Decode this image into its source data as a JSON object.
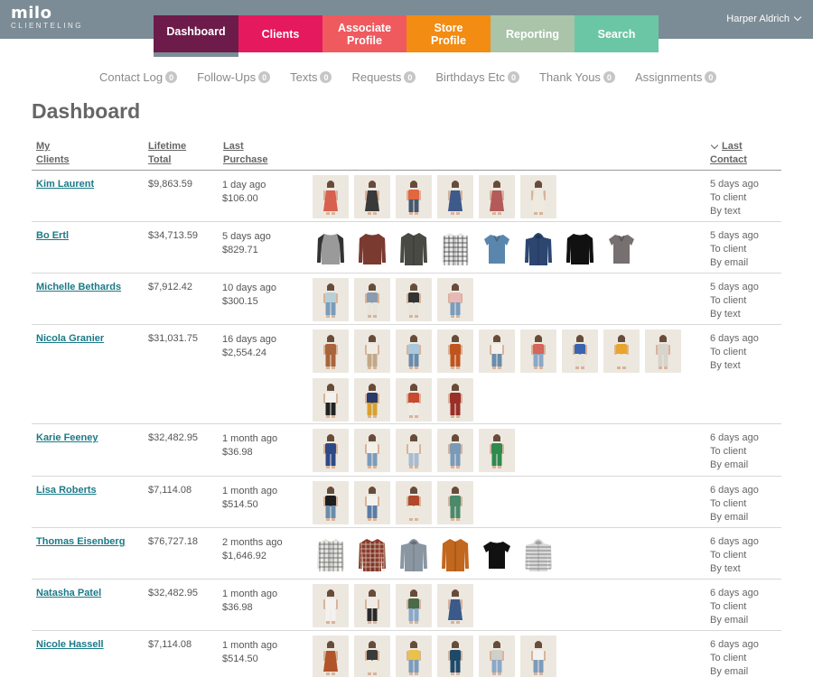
{
  "app": {
    "logo_main": "milo",
    "logo_sub": "CLIENTELING"
  },
  "user": {
    "name": "Harper Aldrich"
  },
  "nav": {
    "tabs": [
      {
        "label": "Dashboard",
        "color": "#6d1b4a",
        "active": true
      },
      {
        "label": "Clients",
        "color": "#e5195e",
        "active": false
      },
      {
        "label": "Associate Profile",
        "color": "#ef5a5f",
        "active": false
      },
      {
        "label": "Store Profile",
        "color": "#f28c13",
        "active": false
      },
      {
        "label": "Reporting",
        "color": "#a9c4a9",
        "active": false
      },
      {
        "label": "Search",
        "color": "#6bc6a6",
        "active": false
      }
    ]
  },
  "subnav": [
    {
      "label": "Contact Log",
      "count": "0"
    },
    {
      "label": "Follow-Ups",
      "count": "0"
    },
    {
      "label": "Texts",
      "count": "0"
    },
    {
      "label": "Requests",
      "count": "0"
    },
    {
      "label": "Birthdays Etc",
      "count": "0"
    },
    {
      "label": "Thank Yous",
      "count": "0"
    },
    {
      "label": "Assignments",
      "count": "0"
    }
  ],
  "page_title": "Dashboard",
  "table": {
    "headers": {
      "clients_l1": "My",
      "clients_l2": "Clients",
      "total_l1": "Lifetime",
      "total_l2": "Total",
      "purchase_l1": "Last",
      "purchase_l2": "Purchase",
      "contact_l1": "Last",
      "contact_l2": "Contact"
    },
    "rows": [
      {
        "name": "Kim Laurent",
        "total": "$9,863.59",
        "purchase_when": "1 day ago",
        "purchase_amount": "$106.00",
        "contact_when": "5 days ago",
        "contact_who": "To client",
        "contact_how": "By text",
        "items": [
          {
            "type": "model",
            "top": "#d8604e",
            "bottom": "#d8604e",
            "dress": true
          },
          {
            "type": "model",
            "top": "#3a3a3a",
            "bottom": "#3a3a3a",
            "dress": true
          },
          {
            "type": "model",
            "top": "#e0673e",
            "bottom": "#46586e",
            "dress": false
          },
          {
            "type": "model",
            "top": "#3e5a8a",
            "bottom": "#3e5a8a",
            "dress": true
          },
          {
            "type": "model",
            "top": "#b45a5a",
            "bottom": "#b45a5a",
            "dress": true
          },
          {
            "type": "model",
            "top": "#eeeae0",
            "bottom": "#eeeae0",
            "dress": true
          }
        ]
      },
      {
        "name": "Bo Ertl",
        "total": "$34,713.59",
        "purchase_when": "5 days ago",
        "purchase_amount": "$829.71",
        "contact_when": "5 days ago",
        "contact_who": "To client",
        "contact_how": "By email",
        "items": [
          {
            "type": "sweater",
            "color": "#9a9a9a",
            "sleeve": "#333333"
          },
          {
            "type": "sweater",
            "color": "#7a3a30",
            "sleeve": "#7a3a30"
          },
          {
            "type": "shirt",
            "color": "#4a4a44",
            "pattern": "none"
          },
          {
            "type": "shirt",
            "color": "#e8e8e8",
            "pattern": "plaid",
            "pattern_color": "#333333"
          },
          {
            "type": "polo",
            "color": "#5a86ad"
          },
          {
            "type": "hoodie",
            "color": "#2c4670"
          },
          {
            "type": "sweater",
            "color": "#111111",
            "sleeve": "#111111"
          },
          {
            "type": "polo",
            "color": "#777070"
          }
        ]
      },
      {
        "name": "Michelle Bethards",
        "total": "$7,912.42",
        "purchase_when": "10 days ago",
        "purchase_amount": "$300.15",
        "contact_when": "5 days ago",
        "contact_who": "To client",
        "contact_how": "By text",
        "items": [
          {
            "type": "model",
            "top": "#b8cfd8",
            "bottom": "#7a9cbc",
            "dress": false
          },
          {
            "type": "model",
            "top": "#8a9bb0",
            "bottom": "#e8e4da",
            "dress": false
          },
          {
            "type": "model",
            "top": "#333333",
            "bottom": "#e8e4da",
            "dress": false
          },
          {
            "type": "model",
            "top": "#e8b8b8",
            "bottom": "#7a9cbc",
            "dress": false
          }
        ]
      },
      {
        "name": "Nicola Granier",
        "total": "$31,031.75",
        "purchase_when": "16 days ago",
        "purchase_amount": "$2,554.24",
        "contact_when": "6 days ago",
        "contact_who": "To client",
        "contact_how": "By text",
        "items": [
          {
            "type": "model",
            "top": "#a8643a",
            "bottom": "#a8643a",
            "dress": false
          },
          {
            "type": "model",
            "top": "#f0ece4",
            "bottom": "#c2a888",
            "dress": false
          },
          {
            "type": "model",
            "top": "#aac8dc",
            "bottom": "#6a8cac",
            "dress": false
          },
          {
            "type": "model",
            "top": "#c0541e",
            "bottom": "#c0541e",
            "dress": false
          },
          {
            "type": "model",
            "top": "#f4f0ea",
            "bottom": "#6a8cac",
            "dress": false
          },
          {
            "type": "model",
            "top": "#d4665a",
            "bottom": "#8aa8c8",
            "dress": false
          },
          {
            "type": "model",
            "top": "#3a64b0",
            "bottom": "#e8e4da",
            "dress": false
          },
          {
            "type": "model",
            "top": "#e8a42c",
            "bottom": "#ece8dc",
            "dress": false
          },
          {
            "type": "model",
            "top": "#d8d4cc",
            "bottom": "#d8d4cc",
            "dress": false
          },
          {
            "type": "model",
            "top": "#f4f2ee",
            "bottom": "#222222",
            "dress": false
          },
          {
            "type": "model",
            "top": "#2a3a6a",
            "bottom": "#d8a030",
            "dress": false
          },
          {
            "type": "model",
            "top": "#c84a30",
            "bottom": "#f0ece4",
            "dress": false
          },
          {
            "type": "model",
            "top": "#9a2e28",
            "bottom": "#9a2e28",
            "dress": false
          }
        ]
      },
      {
        "name": "Karie Feeney",
        "total": "$32,482.95",
        "purchase_when": "1 month ago",
        "purchase_amount": "$36.98",
        "contact_when": "6 days ago",
        "contact_who": "To client",
        "contact_how": "By email",
        "items": [
          {
            "type": "model",
            "top": "#2e4a86",
            "bottom": "#2e4a86",
            "dress": false
          },
          {
            "type": "model",
            "top": "#f4f0ea",
            "bottom": "#7a9cbc",
            "dress": false
          },
          {
            "type": "model",
            "top": "#f0ece4",
            "bottom": "#a8bcd0",
            "dress": false
          },
          {
            "type": "model",
            "top": "#7a9ab8",
            "bottom": "#7a9ab8",
            "dress": false
          },
          {
            "type": "model",
            "top": "#2e8a4e",
            "bottom": "#2e8a4e",
            "dress": false
          }
        ]
      },
      {
        "name": "Lisa Roberts",
        "total": "$7,114.08",
        "purchase_when": "1 month ago",
        "purchase_amount": "$514.50",
        "contact_when": "6 days ago",
        "contact_who": "To client",
        "contact_how": "By email",
        "items": [
          {
            "type": "model",
            "top": "#1e1e1e",
            "bottom": "#6a8cac",
            "dress": false
          },
          {
            "type": "model",
            "top": "#f4f2ee",
            "bottom": "#5a7ca8",
            "dress": false
          },
          {
            "type": "model",
            "top": "#b0482c",
            "bottom": "#ece8dc",
            "dress": false
          },
          {
            "type": "model",
            "top": "#4a8a6a",
            "bottom": "#4a8a6a",
            "dress": false
          }
        ]
      },
      {
        "name": "Thomas Eisenberg",
        "total": "$76,727.18",
        "purchase_when": "2 months ago",
        "purchase_amount": "$1,646.92",
        "contact_when": "6 days ago",
        "contact_who": "To client",
        "contact_how": "By text",
        "items": [
          {
            "type": "shirt",
            "color": "#e4e4e0",
            "pattern": "plaid",
            "pattern_color": "#555555"
          },
          {
            "type": "shirt",
            "color": "#8a3a2c",
            "pattern": "plaid",
            "pattern_color": "#d8d0c0"
          },
          {
            "type": "hoodie",
            "color": "#8a96a2"
          },
          {
            "type": "shirt",
            "color": "#c2671e",
            "pattern": "none"
          },
          {
            "type": "tee",
            "color": "#111111"
          },
          {
            "type": "hoodie",
            "color": "#d8d8d8",
            "pattern": "stripe",
            "pattern_color": "#777777"
          }
        ]
      },
      {
        "name": "Natasha Patel",
        "total": "$32,482.95",
        "purchase_when": "1 month ago",
        "purchase_amount": "$36.98",
        "contact_when": "6 days ago",
        "contact_who": "To client",
        "contact_how": "By email",
        "items": [
          {
            "type": "model",
            "top": "#f4f2ee",
            "bottom": "#f4f2ee",
            "dress": false
          },
          {
            "type": "model",
            "top": "#f0ece4",
            "bottom": "#2a2a2a",
            "dress": false
          },
          {
            "type": "model",
            "top": "#4a6a48",
            "bottom": "#8aa8c8",
            "dress": false
          },
          {
            "type": "model",
            "top": "#3a5a8a",
            "bottom": "#3a5a8a",
            "dress": true
          }
        ]
      },
      {
        "name": "Nicole Hassell",
        "total": "$7,114.08",
        "purchase_when": "1 month ago",
        "purchase_amount": "$514.50",
        "contact_when": "6 days ago",
        "contact_who": "To client",
        "contact_how": "By email",
        "items": [
          {
            "type": "model",
            "top": "#b0542a",
            "bottom": "#b0542a",
            "dress": true
          },
          {
            "type": "model",
            "top": "#3a3a3a",
            "bottom": "#ece8dc",
            "dress": false
          },
          {
            "type": "model",
            "top": "#e8c24a",
            "bottom": "#7a9cbc",
            "dress": false
          },
          {
            "type": "model",
            "top": "#1e4a6a",
            "bottom": "#1e4a6a",
            "dress": false
          },
          {
            "type": "model",
            "top": "#d0cfc8",
            "bottom": "#8aa8c8",
            "dress": false
          },
          {
            "type": "model",
            "top": "#f4f2ee",
            "bottom": "#7a9cbc",
            "dress": false
          }
        ]
      }
    ]
  }
}
